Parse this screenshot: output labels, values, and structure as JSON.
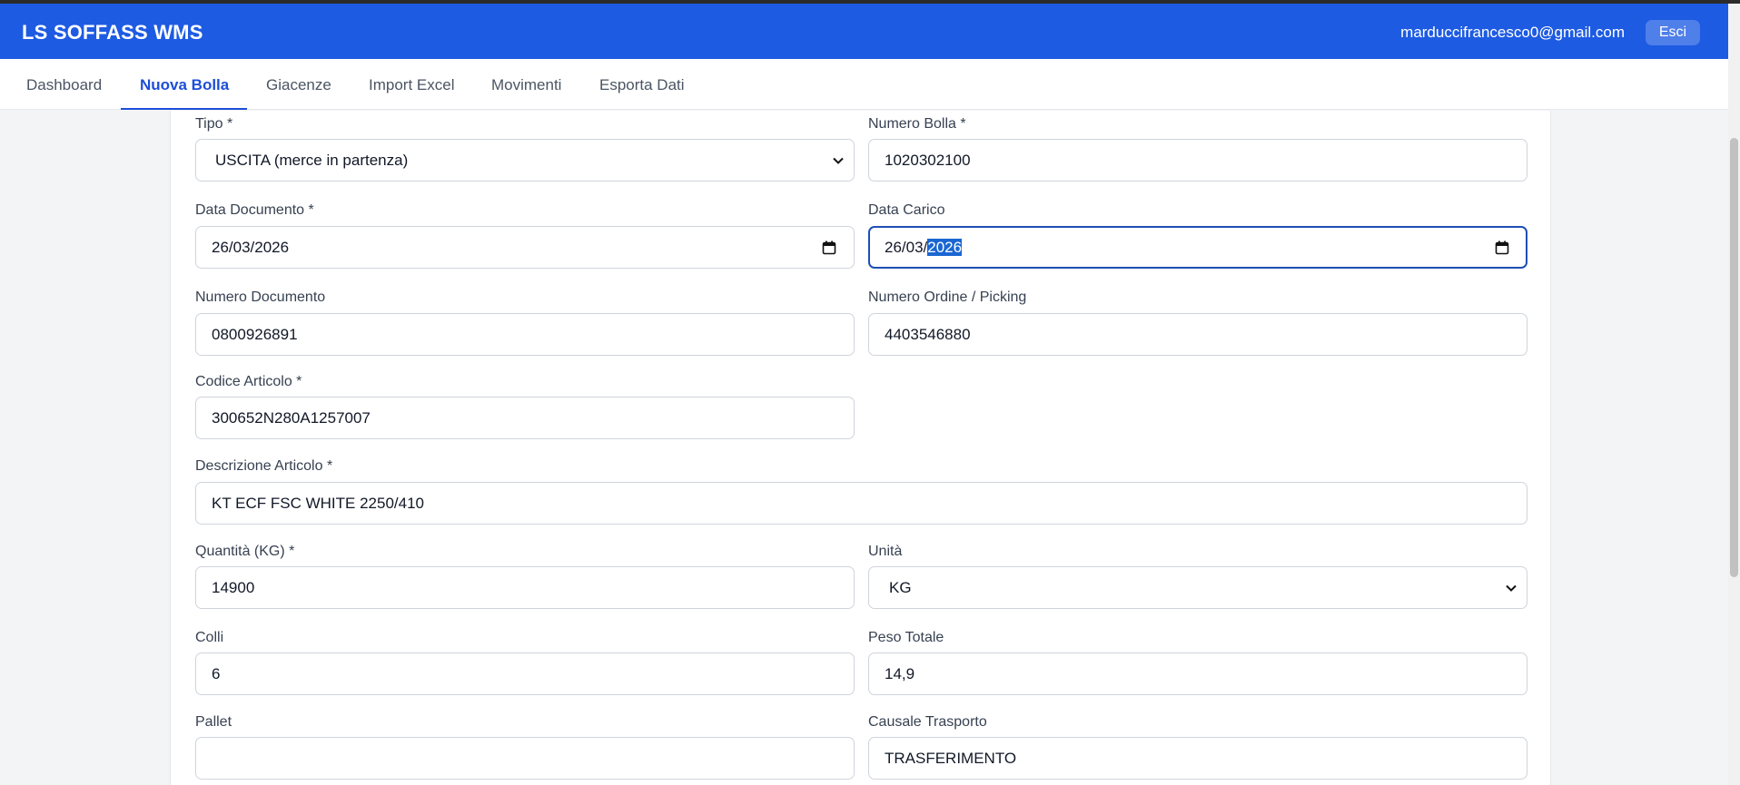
{
  "app": {
    "title": "LS SOFFASS WMS",
    "user_email": "marduccifrancesco0@gmail.com",
    "logout_label": "Esci"
  },
  "nav": {
    "tabs": [
      {
        "label": "Dashboard",
        "active": false
      },
      {
        "label": "Nuova Bolla",
        "active": true
      },
      {
        "label": "Giacenze",
        "active": false
      },
      {
        "label": "Import Excel",
        "active": false
      },
      {
        "label": "Movimenti",
        "active": false
      },
      {
        "label": "Esporta Dati",
        "active": false
      }
    ]
  },
  "form": {
    "tipo": {
      "label": "Tipo *",
      "value": "USCITA (merce in partenza)"
    },
    "numero_bolla": {
      "label": "Numero Bolla *",
      "value": "1020302100"
    },
    "data_documento": {
      "label": "Data Documento *",
      "value": "26/03/2026"
    },
    "data_carico": {
      "label": "Data Carico",
      "value_prefix": "26/03/",
      "value_selected": "2026"
    },
    "numero_documento": {
      "label": "Numero Documento",
      "value": "0800926891"
    },
    "numero_ordine": {
      "label": "Numero Ordine / Picking",
      "value": "4403546880"
    },
    "codice_articolo": {
      "label": "Codice Articolo *",
      "value": "300652N280A1257007"
    },
    "descrizione_articolo": {
      "label": "Descrizione Articolo *",
      "value": "KT ECF FSC WHITE 2250/410"
    },
    "quantita": {
      "label": "Quantità (KG) *",
      "value": "14900"
    },
    "unita": {
      "label": "Unità",
      "value": "KG"
    },
    "colli": {
      "label": "Colli",
      "value": "6"
    },
    "peso_totale": {
      "label": "Peso Totale",
      "value": "14,9"
    },
    "pallet": {
      "label": "Pallet",
      "value": ""
    },
    "causale_trasporto": {
      "label": "Causale Trasporto",
      "value": "TRASFERIMENTO"
    }
  },
  "icons": {
    "select_arrow": "chevron-down-icon",
    "date_picker": "calendar-icon"
  },
  "colors": {
    "header": "#1e5be3",
    "active_tab": "#1d4ed8",
    "selection": "#1a66d2"
  }
}
